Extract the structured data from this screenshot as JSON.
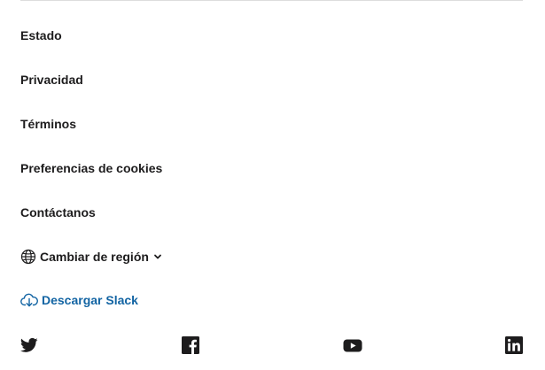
{
  "footer": {
    "links": [
      {
        "label": "Estado"
      },
      {
        "label": "Privacidad"
      },
      {
        "label": "Términos"
      },
      {
        "label": "Preferencias de cookies"
      },
      {
        "label": "Contáctanos"
      }
    ],
    "region_label": "Cambiar de región",
    "download_label": "Descargar Slack",
    "social_icons": [
      "twitter-icon",
      "facebook-icon",
      "youtube-icon",
      "linkedin-icon"
    ]
  },
  "colors": {
    "text": "#1d1c1d",
    "accent": "#1264a3",
    "divider": "#dddddd"
  }
}
